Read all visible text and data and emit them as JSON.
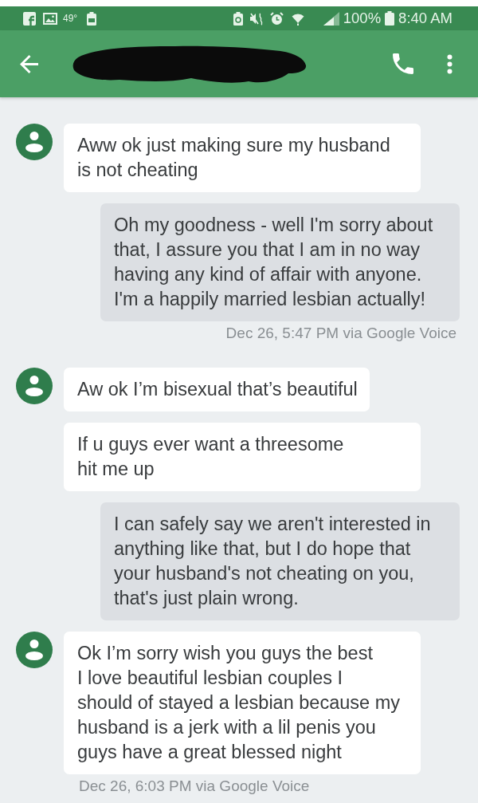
{
  "status_bar": {
    "temperature": "49°",
    "battery": "100%",
    "time": "8:40 AM"
  },
  "messages": [
    {
      "kind": "received",
      "avatar": true,
      "text": "Aww ok just making sure my husband\nis not cheating"
    },
    {
      "kind": "sent",
      "text": "Oh my goodness - well I'm sorry about\nthat, I assure you that I am in no way\nhaving any kind of affair with anyone.\nI'm a happily married lesbian actually!",
      "timestamp": "Dec 26, 5:47 PM via Google Voice"
    },
    {
      "kind": "received",
      "avatar": true,
      "text": "Aw ok I’m bisexual that’s beautiful"
    },
    {
      "kind": "received",
      "avatar": false,
      "text": "If u guys ever want a threesome\nhit me up"
    },
    {
      "kind": "sent",
      "text": "I can safely say we aren't interested in\nanything like that, but I do hope that\nyour husband's not cheating on you,\nthat's just plain wrong."
    },
    {
      "kind": "received",
      "avatar": true,
      "text": "Ok I’m sorry wish you guys the best\nI love beautiful lesbian couples I\nshould of stayed a lesbian because my\nhusband is a jerk with a lil penis you\nguys have a great blessed night",
      "timestamp": "Dec 26, 6:03 PM via Google Voice"
    }
  ]
}
